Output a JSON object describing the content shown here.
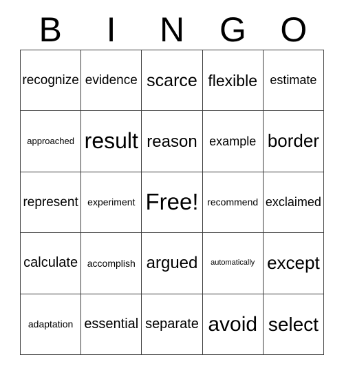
{
  "card": {
    "header": {
      "letters": [
        "B",
        "I",
        "N",
        "G",
        "O"
      ]
    },
    "grid": {
      "columns": 5,
      "rows": 5,
      "cells": [
        {
          "text": "recognize",
          "font_size": 19
        },
        {
          "text": "evidence",
          "font_size": 19
        },
        {
          "text": "scarce",
          "font_size": 25
        },
        {
          "text": "flexible",
          "font_size": 23
        },
        {
          "text": "estimate",
          "font_size": 18
        },
        {
          "text": "approached",
          "font_size": 13
        },
        {
          "text": "result",
          "font_size": 32
        },
        {
          "text": "reason",
          "font_size": 24
        },
        {
          "text": "example",
          "font_size": 18
        },
        {
          "text": "border",
          "font_size": 26
        },
        {
          "text": "represent",
          "font_size": 19
        },
        {
          "text": "experiment",
          "font_size": 14
        },
        {
          "text": "Free!",
          "font_size": 33
        },
        {
          "text": "recommend",
          "font_size": 14
        },
        {
          "text": "exclaimed",
          "font_size": 18
        },
        {
          "text": "calculate",
          "font_size": 20
        },
        {
          "text": "accomplish",
          "font_size": 14
        },
        {
          "text": "argued",
          "font_size": 24
        },
        {
          "text": "automatically",
          "font_size": 11
        },
        {
          "text": "except",
          "font_size": 26
        },
        {
          "text": "adaptation",
          "font_size": 14
        },
        {
          "text": "essential",
          "font_size": 20
        },
        {
          "text": "separate",
          "font_size": 20
        },
        {
          "text": "avoid",
          "font_size": 30
        },
        {
          "text": "select",
          "font_size": 28
        }
      ]
    },
    "colors": {
      "background": "#ffffff",
      "border": "#3c3c3c",
      "text": "#000000"
    }
  }
}
